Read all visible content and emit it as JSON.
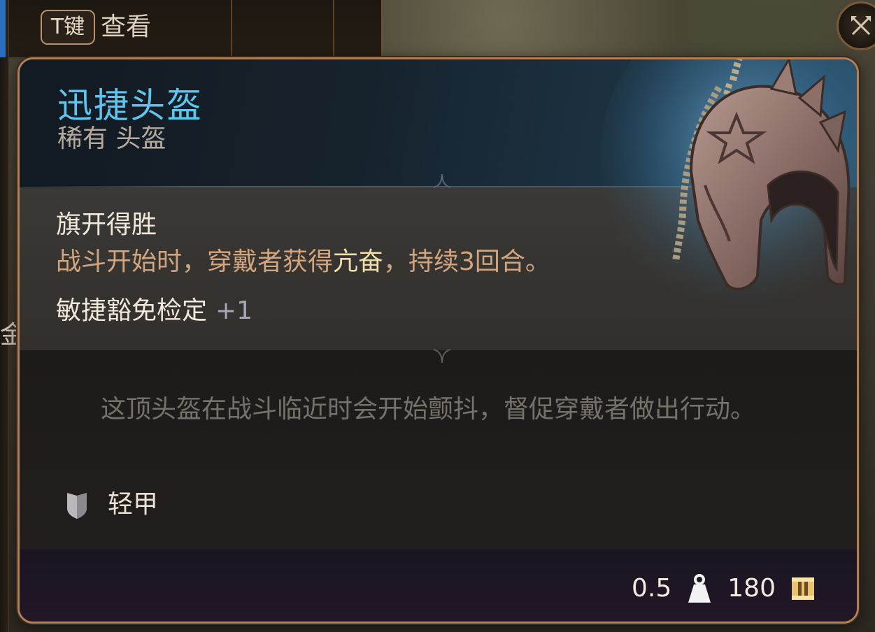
{
  "hint": {
    "key": "T键",
    "action": "查看"
  },
  "background": {
    "edge_glyph": "金"
  },
  "item": {
    "name": "迅捷头盔",
    "type_line": "稀有 头盔",
    "name_color": "#5ec6ee",
    "image_icon": "helmet-icon"
  },
  "passive": {
    "name": "旗开得胜",
    "desc_before": "战斗开始时，穿戴者获得",
    "keyword": "亢奋",
    "desc_after": "，持续3回合。"
  },
  "save_bonus": {
    "label": "敏捷豁免检定",
    "value": "+1"
  },
  "flavor_text": "这顶头盔在战斗临近时会开始颤抖，督促穿戴者做出行动。",
  "armor": {
    "icon": "shield-icon",
    "label": "轻甲"
  },
  "footer": {
    "weight": "0.5",
    "weight_icon": "weight-icon",
    "value": "180",
    "value_icon": "gold-coin-icon"
  },
  "colors": {
    "frame": "#b07f58",
    "passive_desc": "#d3a57e",
    "keyword": "#f1deaa",
    "flavor": "#77716b"
  }
}
